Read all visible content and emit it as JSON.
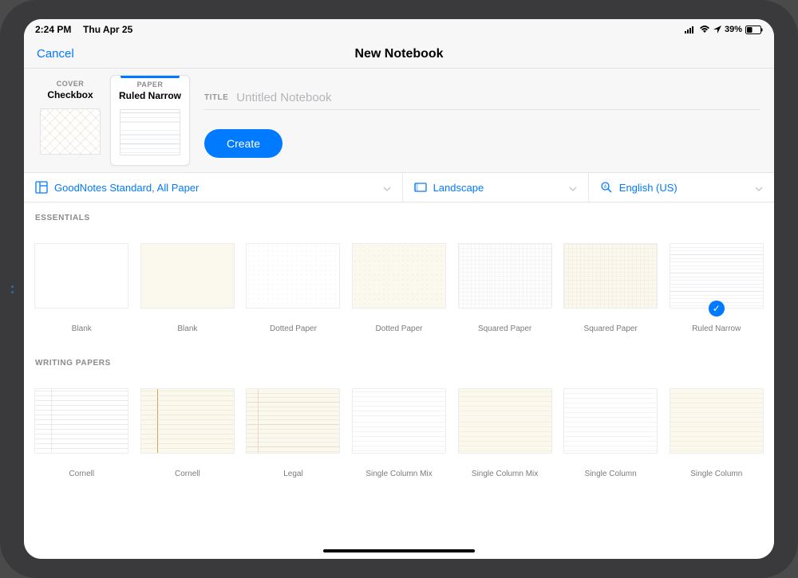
{
  "status": {
    "time": "2:24 PM",
    "date": "Thu Apr 25",
    "battery": "39%",
    "icons": "▮"
  },
  "nav": {
    "cancel": "Cancel",
    "title": "New Notebook"
  },
  "header": {
    "cover": {
      "sup": "COVER",
      "main": "Checkbox"
    },
    "paper": {
      "sup": "PAPER",
      "main": "Ruled Narrow"
    },
    "title_label": "TITLE",
    "title_placeholder": "Untitled Notebook",
    "create": "Create"
  },
  "filters": {
    "size": "GoodNotes Standard, All Paper",
    "orientation": "Landscape",
    "language": "English (US)"
  },
  "sections": {
    "essentials": {
      "label": "ESSENTIALS",
      "items": [
        "Blank",
        "Blank",
        "Dotted Paper",
        "Dotted Paper",
        "Squared Paper",
        "Squared Paper",
        "Ruled Narrow"
      ]
    },
    "writing": {
      "label": "WRITING PAPERS",
      "items": [
        "Cornell",
        "Cornell",
        "Legal",
        "Single Column Mix",
        "Single Column Mix",
        "Single Column",
        "Single Column"
      ]
    }
  }
}
